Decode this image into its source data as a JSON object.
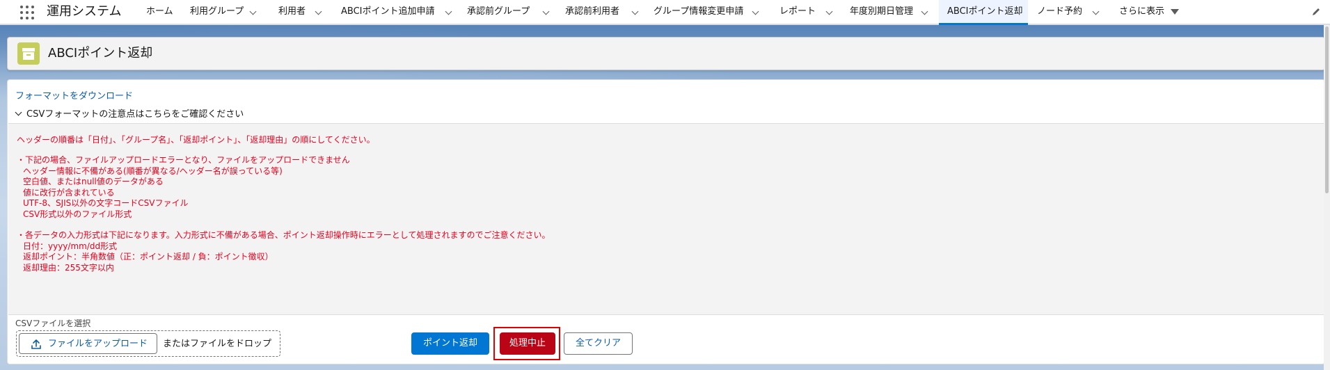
{
  "app": {
    "name": "運用システム"
  },
  "nav": {
    "items": [
      {
        "label": "ホーム",
        "has_menu": false
      },
      {
        "label": "利用グループ",
        "has_menu": true
      },
      {
        "label": "利用者",
        "has_menu": true
      },
      {
        "label": "ABCIポイント追加申請",
        "has_menu": true
      },
      {
        "label": "承認前グループ",
        "has_menu": true
      },
      {
        "label": "承認前利用者",
        "has_menu": true
      },
      {
        "label": "グループ情報変更申請",
        "has_menu": true
      },
      {
        "label": "レポート",
        "has_menu": true
      },
      {
        "label": "年度別期日管理",
        "has_menu": true
      },
      {
        "label": "ABCIポイント返却",
        "has_menu": false,
        "active": true
      },
      {
        "label": "ノード予約",
        "has_menu": true
      }
    ],
    "more_label": "さらに表示"
  },
  "page_header": {
    "title": "ABCIポイント返却",
    "icon": "archive-box-icon",
    "icon_color": "#c5ce5b"
  },
  "main": {
    "download_link": "フォーマットをダウンロード",
    "section_toggle": "CSVフォーマットの注意点はこちらをご確認ください",
    "notes": [
      "ヘッダーの順番は「日付」、「グループ名」、「返却ポイント」、「返却理由」の順にしてください。",
      "・下記の場合、ファイルアップロードエラーとなり、ファイルをアップロードできません",
      "ヘッダー情報に不備がある(順番が異なる/ヘッダー名が誤っている等)",
      "空白値、またはnull値のデータがある",
      "値に改行が含まれている",
      "UTF-8、SJIS以外の文字コードCSVファイル",
      "CSV形式以外のファイル形式",
      "・各データの入力形式は下記になります。入力形式に不備がある場合、ポイント返却操作時にエラーとして処理されますのでご注意ください。",
      "日付：yyyy/mm/dd形式",
      "返却ポイント：半角数値（正：ポイント返却 / 負：ポイント徴収）",
      "返却理由：255文字以内"
    ],
    "file_label": "CSVファイルを選択",
    "upload_button": "ファイルをアップロード",
    "drop_text": "またはファイルをドロップ",
    "buttons": {
      "return_points": "ポイント返却",
      "stop_processing": "処理中止",
      "clear_all": "全てクリア"
    }
  },
  "colors": {
    "brand": "#0176d3",
    "danger": "#ba0517",
    "note_text": "#ea001e",
    "link": "#0b5cab"
  }
}
